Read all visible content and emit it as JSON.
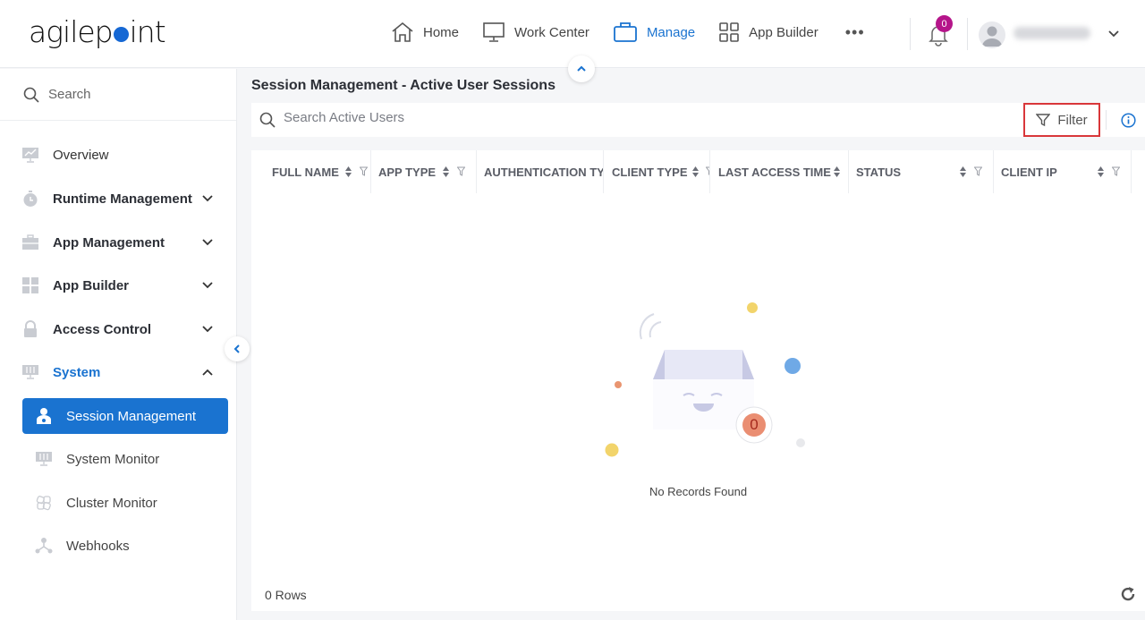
{
  "brand": {
    "logo_text_before": "agilep",
    "logo_text_after": "int",
    "accent_color": "#1a73d0"
  },
  "nav": {
    "items": [
      {
        "label": "Home",
        "icon": "home-icon",
        "active": false
      },
      {
        "label": "Work Center",
        "icon": "monitor-icon",
        "active": false
      },
      {
        "label": "Manage",
        "icon": "briefcase-icon",
        "active": true
      },
      {
        "label": "App Builder",
        "icon": "grid-icon",
        "active": false
      }
    ],
    "more_label": "•••",
    "notifications_count": "0"
  },
  "sidebar": {
    "search_placeholder": "Search",
    "items": [
      {
        "label": "Overview",
        "icon": "chart-monitor-icon",
        "expandable": false
      },
      {
        "label": "Runtime Management",
        "icon": "stopwatch-icon",
        "expandable": true
      },
      {
        "label": "App Management",
        "icon": "toolbox-icon",
        "expandable": true
      },
      {
        "label": "App Builder",
        "icon": "app-grid-icon",
        "expandable": true
      },
      {
        "label": "Access Control",
        "icon": "lock-icon",
        "expandable": true
      },
      {
        "label": "System",
        "icon": "server-icon",
        "expandable": true,
        "expanded": true
      }
    ],
    "sub_items": [
      {
        "label": "Session Management",
        "icon": "user-session-icon",
        "active": true
      },
      {
        "label": "System Monitor",
        "icon": "system-monitor-icon",
        "active": false
      },
      {
        "label": "Cluster Monitor",
        "icon": "cluster-icon",
        "active": false
      },
      {
        "label": "Webhooks",
        "icon": "webhook-icon",
        "active": false
      }
    ]
  },
  "main": {
    "title": "Session Management - Active User Sessions",
    "search_placeholder": "Search Active Users",
    "search_value": "",
    "filter_label": "Filter",
    "columns": [
      {
        "label": "FULL NAME"
      },
      {
        "label": "APP TYPE"
      },
      {
        "label": "AUTHENTICATION TYPE"
      },
      {
        "label": "CLIENT TYPE"
      },
      {
        "label": "LAST ACCESS TIME"
      },
      {
        "label": "STATUS"
      },
      {
        "label": "CLIENT IP"
      }
    ],
    "empty_badge": "0",
    "empty_text": "No Records Found",
    "rows_count": "0 Rows"
  }
}
